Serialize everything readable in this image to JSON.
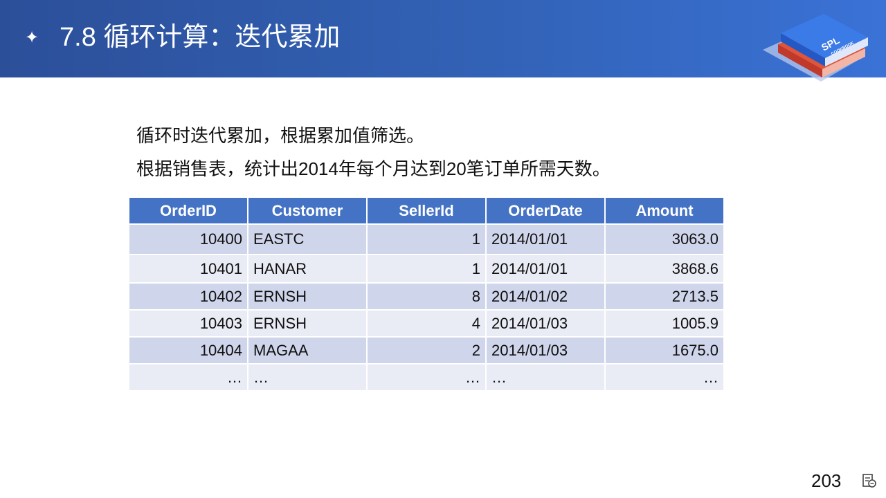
{
  "header": {
    "bullet": "✦",
    "title": "7.8  循环计算：迭代累加",
    "logo_text": "SPL",
    "logo_subtext": "COOKBOOK"
  },
  "body": {
    "lines": [
      "循环时迭代累加，根据累加值筛选。",
      "根据销售表，统计出2014年每个月达到20笔订单所需天数。"
    ]
  },
  "table": {
    "columns": [
      "OrderID",
      "Customer",
      "SellerId",
      "OrderDate",
      "Amount"
    ],
    "rows": [
      [
        "10400",
        "EASTC",
        "1",
        "2014/01/01",
        "3063.0"
      ],
      [
        "10401",
        "HANAR",
        "1",
        "2014/01/01",
        "3868.6"
      ],
      [
        "10402",
        "ERNSH",
        "8",
        "2014/01/02",
        "2713.5"
      ],
      [
        "10403",
        "ERNSH",
        "4",
        "2014/01/03",
        "1005.9"
      ],
      [
        "10404",
        "MAGAA",
        "2",
        "2014/01/03",
        "1675.0"
      ],
      [
        "…",
        "…",
        "…",
        "…",
        "…"
      ]
    ]
  },
  "footer": {
    "page_number": "203"
  },
  "colors": {
    "header_bg": "#2c4f99",
    "table_header": "#4472c4",
    "row_dark": "#cfd5ea",
    "row_light": "#e9ebf5"
  }
}
